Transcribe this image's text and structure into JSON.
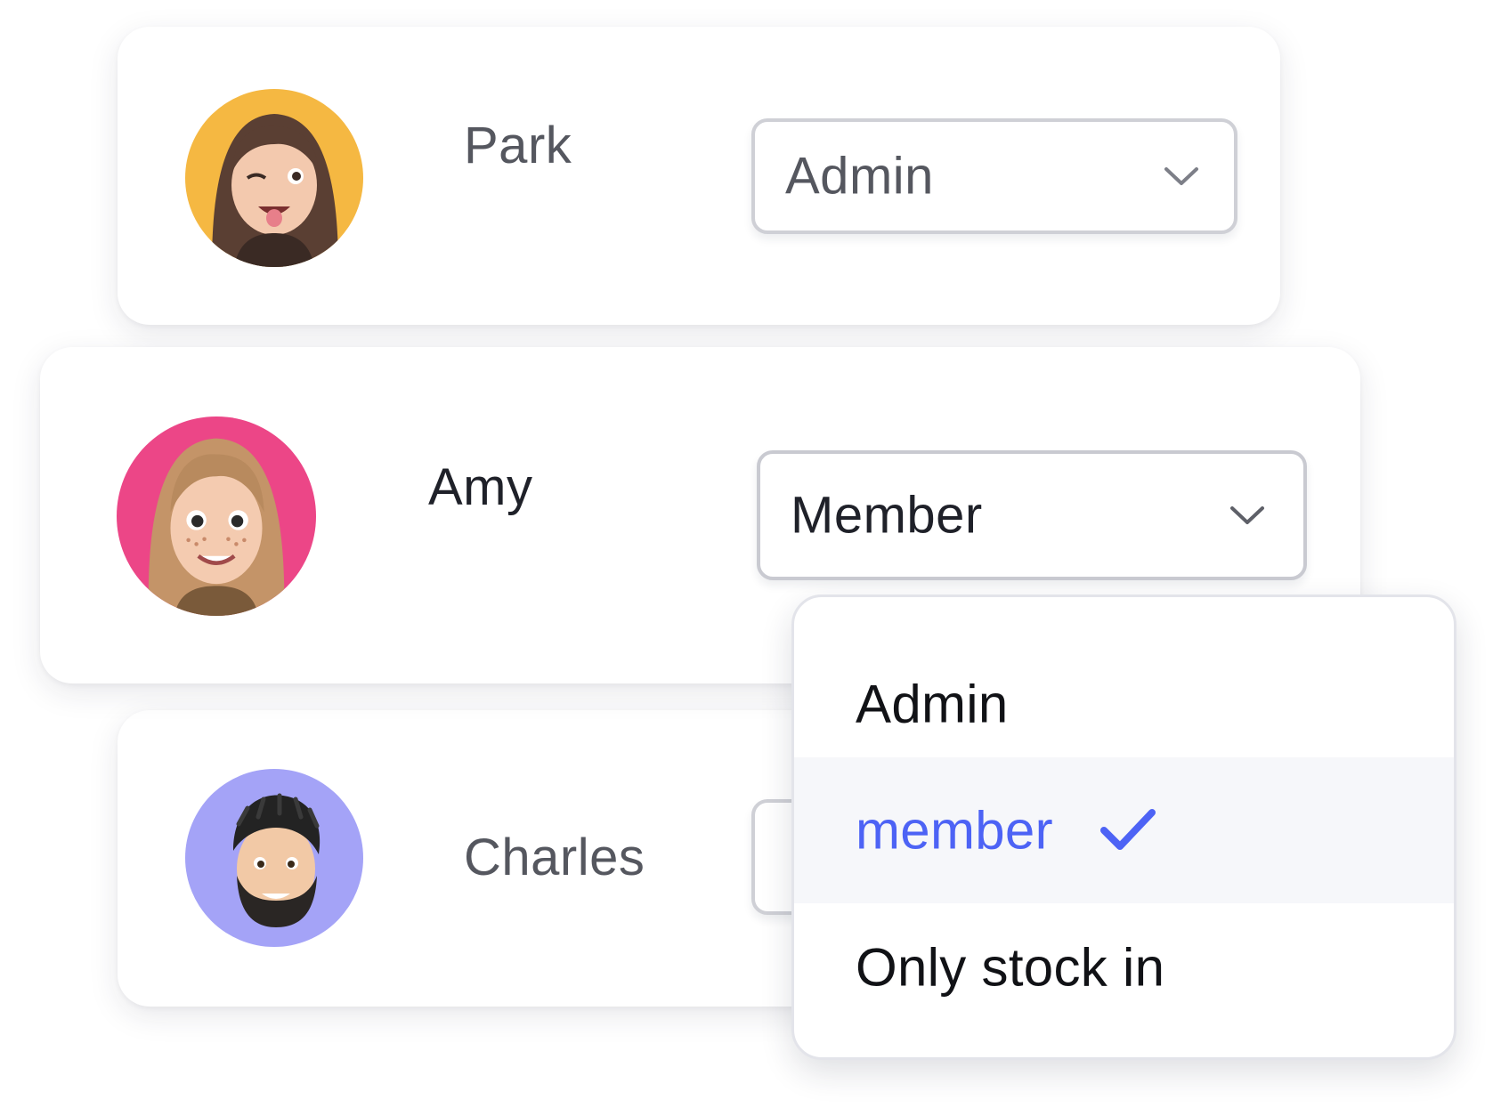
{
  "users": [
    {
      "name": "Park",
      "role": "Admin",
      "avatar_background": "#f5b842",
      "avatar_icon": "woman-long-dark-hair-winking-memoji"
    },
    {
      "name": "Amy",
      "role": "Member",
      "avatar_background": "#ec4687",
      "avatar_icon": "woman-long-blonde-hair-freckles-memoji"
    },
    {
      "name": "Charles",
      "role": "",
      "avatar_background": "#a4a3f7",
      "avatar_icon": "man-dreadlocks-beard-memoji"
    }
  ],
  "role_dropdown": {
    "open_for": "Amy",
    "options": [
      {
        "label": "Admin",
        "selected": false
      },
      {
        "label": "member",
        "selected": true
      },
      {
        "label": "Only stock in",
        "selected": false
      }
    ],
    "selected_color": "#4d63f5"
  },
  "icons": {
    "chevron": "chevron-down-icon",
    "check": "checkmark-icon"
  }
}
